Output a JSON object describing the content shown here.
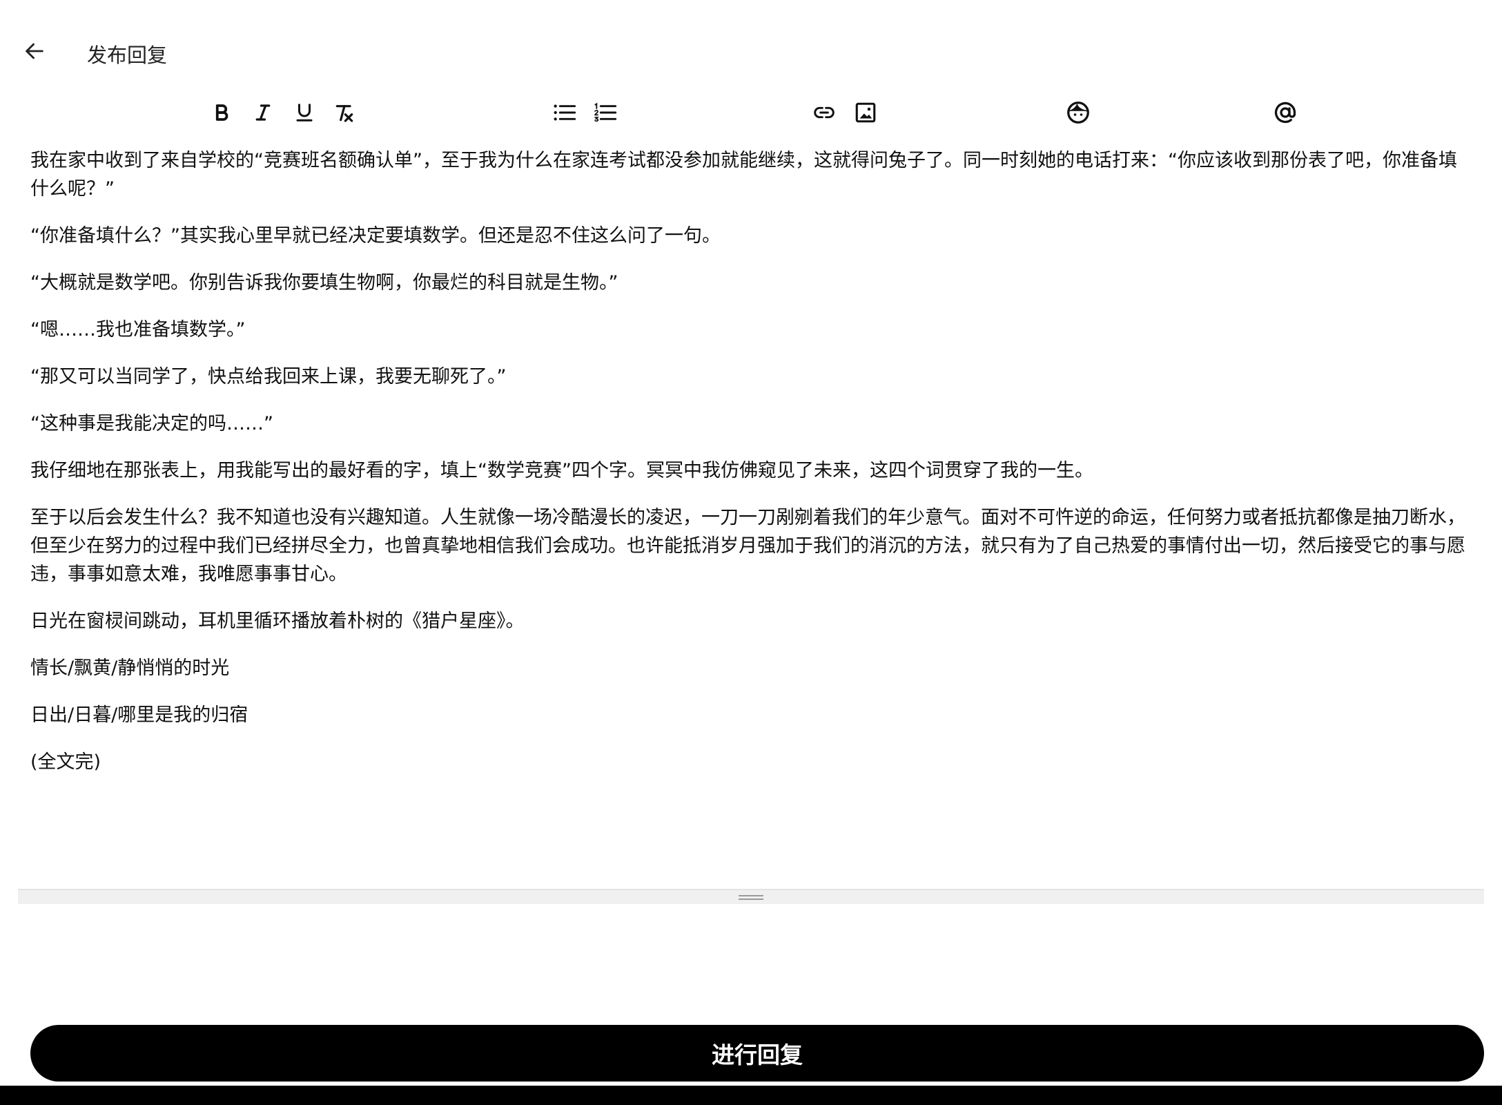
{
  "header": {
    "back_icon": "arrow-left-icon",
    "title": "发布回复"
  },
  "toolbar": {
    "tools": [
      "bold-icon",
      "italic-icon",
      "underline-icon",
      "clear-format-icon",
      "bulleted-list-icon",
      "numbered-list-icon",
      "link-icon",
      "image-icon",
      "emoji-icon",
      "mention-icon"
    ]
  },
  "editor": {
    "paragraphs": [
      "我在家中收到了来自学校的“竞赛班名额确认单”，至于我为什么在家连考试都没参加就能继续，这就得问兔子了。同一时刻她的电话打来：“你应该收到那份表了吧，你准备填什么呢？”",
      "“你准备填什么？”其实我心里早就已经决定要填数学。但还是忍不住这么问了一句。",
      "“大概就是数学吧。你别告诉我你要填生物啊，你最烂的科目就是生物。”",
      "“嗯……我也准备填数学。”",
      "“那又可以当同学了，快点给我回来上课，我要无聊死了。”",
      "“这种事是我能决定的吗……”",
      "我仔细地在那张表上，用我能写出的最好看的字，填上“数学竞赛”四个字。冥冥中我仿佛窥见了未来，这四个词贯穿了我的一生。",
      "至于以后会发生什么？我不知道也没有兴趣知道。人生就像一场冷酷漫长的凌迟，一刀一刀剐剜着我们的年少意气。面对不可忤逆的命运，任何努力或者抵抗都像是抽刀断水，但至少在努力的过程中我们已经拼尽全力，也曾真挚地相信我们会成功。也许能抵消岁月强加于我们的消沉的方法，就只有为了自己热爱的事情付出一切，然后接受它的事与愿违，事事如意太难，我唯愿事事甘心。",
      "日光在窗棂间跳动，耳机里循环播放着朴树的《猎户星座》。",
      "情长/飘黄/静悄悄的时光",
      "日出/日暮/哪里是我的归宿",
      "(全文完)"
    ]
  },
  "footer": {
    "submit_label": "进行回复"
  },
  "colors": {
    "accent": "#000000",
    "background": "#ffffff",
    "text": "#111111"
  }
}
